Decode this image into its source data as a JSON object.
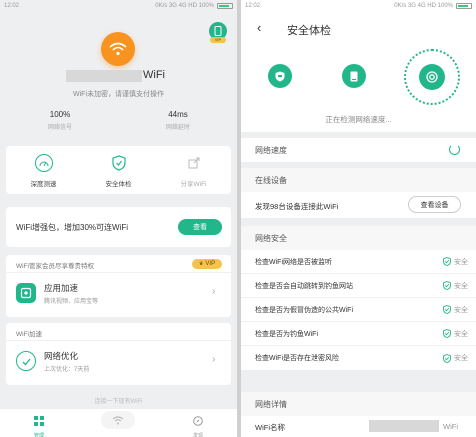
{
  "left": {
    "status": {
      "time": "12:02",
      "network": "0K/s 3G 4G HD 100%"
    },
    "vip_badge": "VIP",
    "wifi_name_suffix": "WiFi",
    "warning": "WiFi未加密，请谨慎支付操作",
    "signal_value": "100%",
    "signal_label": "网络信号",
    "latency_value": "44ms",
    "latency_label": "网络延时",
    "tools": [
      {
        "label": "深度测速"
      },
      {
        "label": "安全体检"
      },
      {
        "label": "分享WiFi"
      }
    ],
    "boost": {
      "text": "WiFi增强包，增加30%可连WiFi",
      "button": "查看"
    },
    "vip_card": {
      "title": "WiFi管家会员尽享尊贵特权",
      "badge": "VIP",
      "item_title": "应用加速",
      "item_sub": "腾讯视频、应用宝等"
    },
    "speed_card": {
      "title": "WiFi加速",
      "item_title": "网络优化",
      "item_sub": "上次优化：7天前"
    },
    "bottom_hint": "连接一下现有WiFi",
    "nav": [
      {
        "label": "管理"
      },
      {
        "label": ""
      },
      {
        "label": "发现"
      }
    ]
  },
  "right": {
    "status": {
      "time": "12:02",
      "network": "0K/s 3G 4G HD 100%"
    },
    "title": "安全体检",
    "scanning": "正在检测网络速度...",
    "speed_label": "网络速度",
    "online_header": "在线设备",
    "online_text": "发现98台设备连接此WiFi",
    "online_button": "查看设备",
    "security_header": "网络安全",
    "checks": [
      {
        "text": "检查WiFi网络是否被监听",
        "status": "安全"
      },
      {
        "text": "检查是否会自动跳转到钓鱼网站",
        "status": "安全"
      },
      {
        "text": "检查是否为假冒伪造的公共WiFi",
        "status": "安全"
      },
      {
        "text": "检查是否为钓鱼WiFi",
        "status": "安全"
      },
      {
        "text": "检查WiFi是否存在泄密风险",
        "status": "安全"
      }
    ],
    "detail_header": "网络详情",
    "detail_name_label": "WiFi名称",
    "detail_name_suffix": "WiFi"
  },
  "colors": {
    "accent": "#22b78a",
    "orange": "#f7931e",
    "gold": "#f4c24d"
  }
}
